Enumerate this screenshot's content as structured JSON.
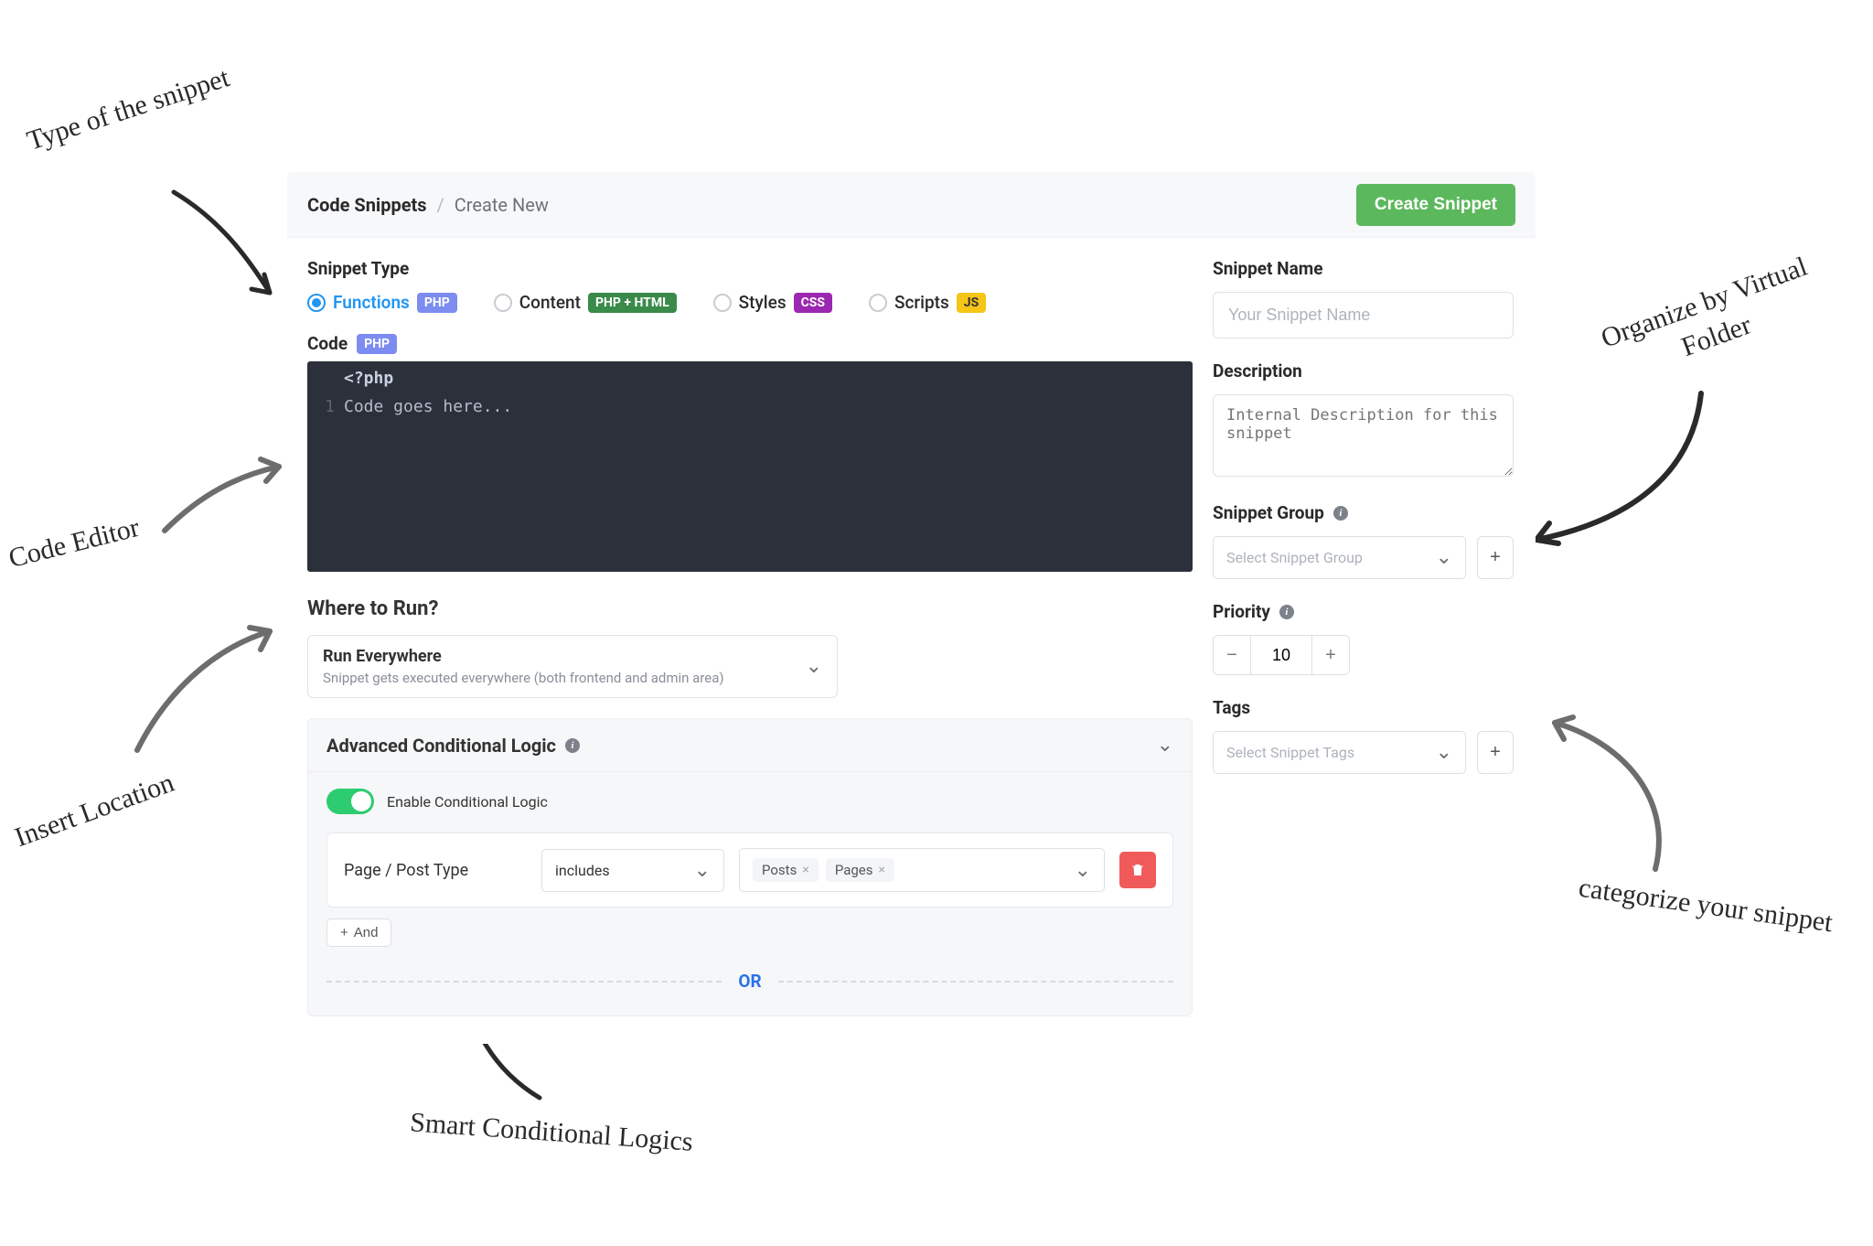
{
  "annotations": {
    "type": "Type of the snippet",
    "editor": "Code Editor",
    "insert": "Insert Location",
    "smart": "Smart Conditional Logics",
    "organize": "Organize by Virtual Folder",
    "categorize": "categorize your snippet"
  },
  "header": {
    "bc_root": "Code Snippets",
    "bc_sep": "/",
    "bc_current": "Create New",
    "create_btn": "Create Snippet"
  },
  "left": {
    "type_label": "Snippet Type",
    "types": [
      {
        "label": "Functions",
        "badge": "PHP",
        "badge_class": "b-php",
        "checked": true
      },
      {
        "label": "Content",
        "badge": "PHP + HTML",
        "badge_class": "b-phphtml",
        "checked": false
      },
      {
        "label": "Styles",
        "badge": "CSS",
        "badge_class": "b-css",
        "checked": false
      },
      {
        "label": "Scripts",
        "badge": "JS",
        "badge_class": "b-js",
        "checked": false
      }
    ],
    "code_label": "Code",
    "code_badge": "PHP",
    "code_open": "<?php",
    "code_line_no": "1",
    "code_placeholder": "Code goes here...",
    "where_title": "Where to Run?",
    "where_select": {
      "title": "Run Everywhere",
      "sub": "Snippet gets executed everywhere (both frontend and admin area)"
    },
    "acl_title": "Advanced Conditional Logic",
    "acl_enable": "Enable Conditional Logic",
    "cond_field": "Page / Post Type",
    "cond_op": "includes",
    "cond_chips": [
      "Posts",
      "Pages"
    ],
    "and_btn": "And",
    "or_text": "OR"
  },
  "right": {
    "name_label": "Snippet Name",
    "name_ph": "Your Snippet Name",
    "desc_label": "Description",
    "desc_ph": "Internal Description for this snippet",
    "group_label": "Snippet Group",
    "group_ph": "Select Snippet Group",
    "priority_label": "Priority",
    "priority_value": "10",
    "tags_label": "Tags",
    "tags_ph": "Select Snippet Tags"
  }
}
